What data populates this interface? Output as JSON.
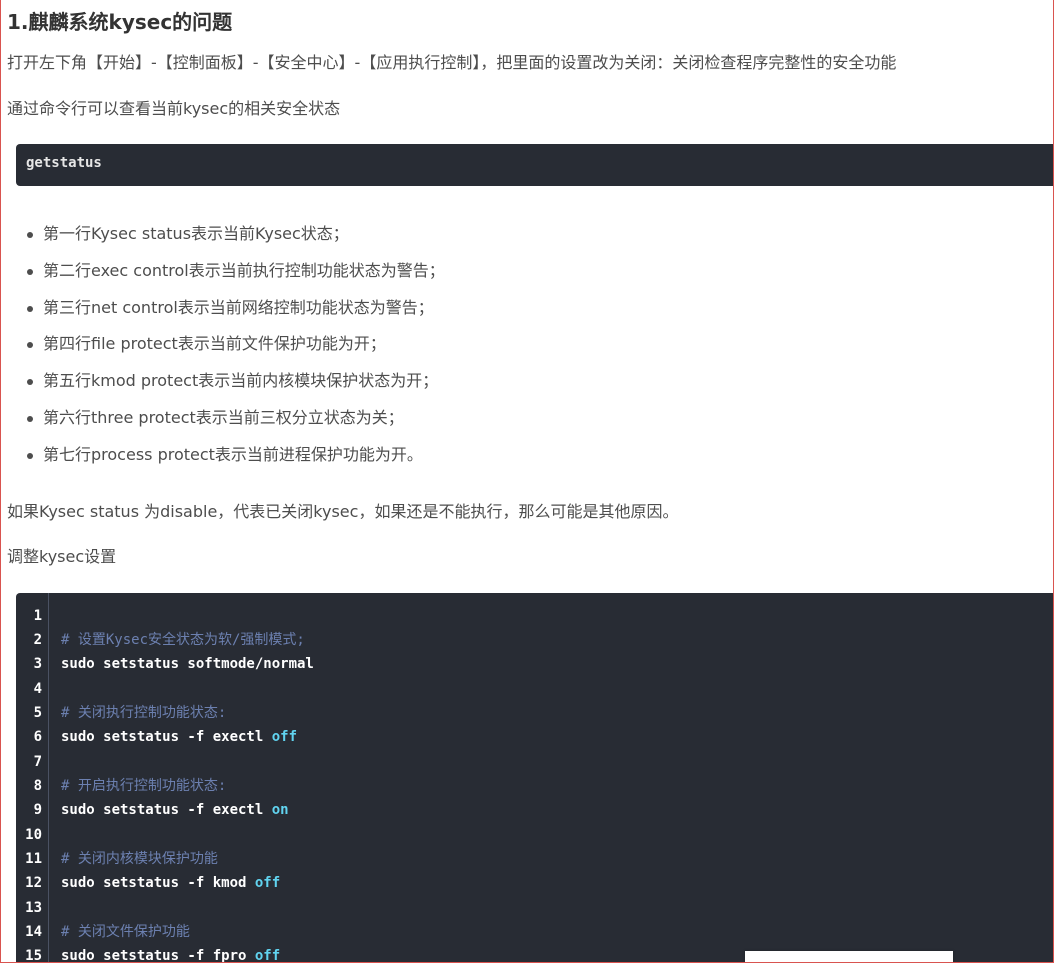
{
  "heading": "1.麒麟系统kysec的问题",
  "para1": "打开左下角【开始】-【控制面板】-【安全中心】-【应用执行控制】，把里面的设置改为关闭：关闭检查程序完整性的安全功能",
  "para2": "通过命令行可以查看当前kysec的相关安全状态",
  "inline_code": "getstatus",
  "bullets": [
    "第一行Kysec status表示当前Kysec状态；",
    "第二行exec control表示当前执行控制功能状态为警告；",
    "第三行net control表示当前网络控制功能状态为警告；",
    "第四行file protect表示当前文件保护功能为开；",
    "第五行kmod protect表示当前内核模块保护状态为开；",
    "第六行three protect表示当前三权分立状态为关；",
    "第七行process protect表示当前进程保护功能为开。"
  ],
  "para3": "如果Kysec status 为disable，代表已关闭kysec，如果还是不能执行，那么可能是其他原因。",
  "para4": "调整kysec设置",
  "code_lines": [
    {
      "n": "1",
      "code": "",
      "kw": ""
    },
    {
      "n": "2",
      "comment": "# 设置Kysec安全状态为软/强制模式;"
    },
    {
      "n": "3",
      "code": "sudo setstatus softmode/normal",
      "kw": ""
    },
    {
      "n": "4",
      "code": "",
      "kw": ""
    },
    {
      "n": "5",
      "comment": "# 关闭执行控制功能状态:"
    },
    {
      "n": "6",
      "code": "sudo setstatus -f exectl ",
      "kw": "off"
    },
    {
      "n": "7",
      "code": "",
      "kw": ""
    },
    {
      "n": "8",
      "comment": "# 开启执行控制功能状态:"
    },
    {
      "n": "9",
      "code": "sudo setstatus -f exectl ",
      "kw": "on"
    },
    {
      "n": "10",
      "code": "",
      "kw": ""
    },
    {
      "n": "11",
      "comment": "# 关闭内核模块保护功能"
    },
    {
      "n": "12",
      "code": "sudo setstatus -f kmod ",
      "kw": "off"
    },
    {
      "n": "13",
      "code": "",
      "kw": ""
    },
    {
      "n": "14",
      "comment": "# 关闭文件保护功能"
    },
    {
      "n": "15",
      "code": "sudo setstatus -f fpro ",
      "kw": "off"
    }
  ],
  "colors": {
    "code_bg": "#282c34",
    "comment": "#6c80b0",
    "keyword": "#61d4f0",
    "border": "#d9534f"
  }
}
